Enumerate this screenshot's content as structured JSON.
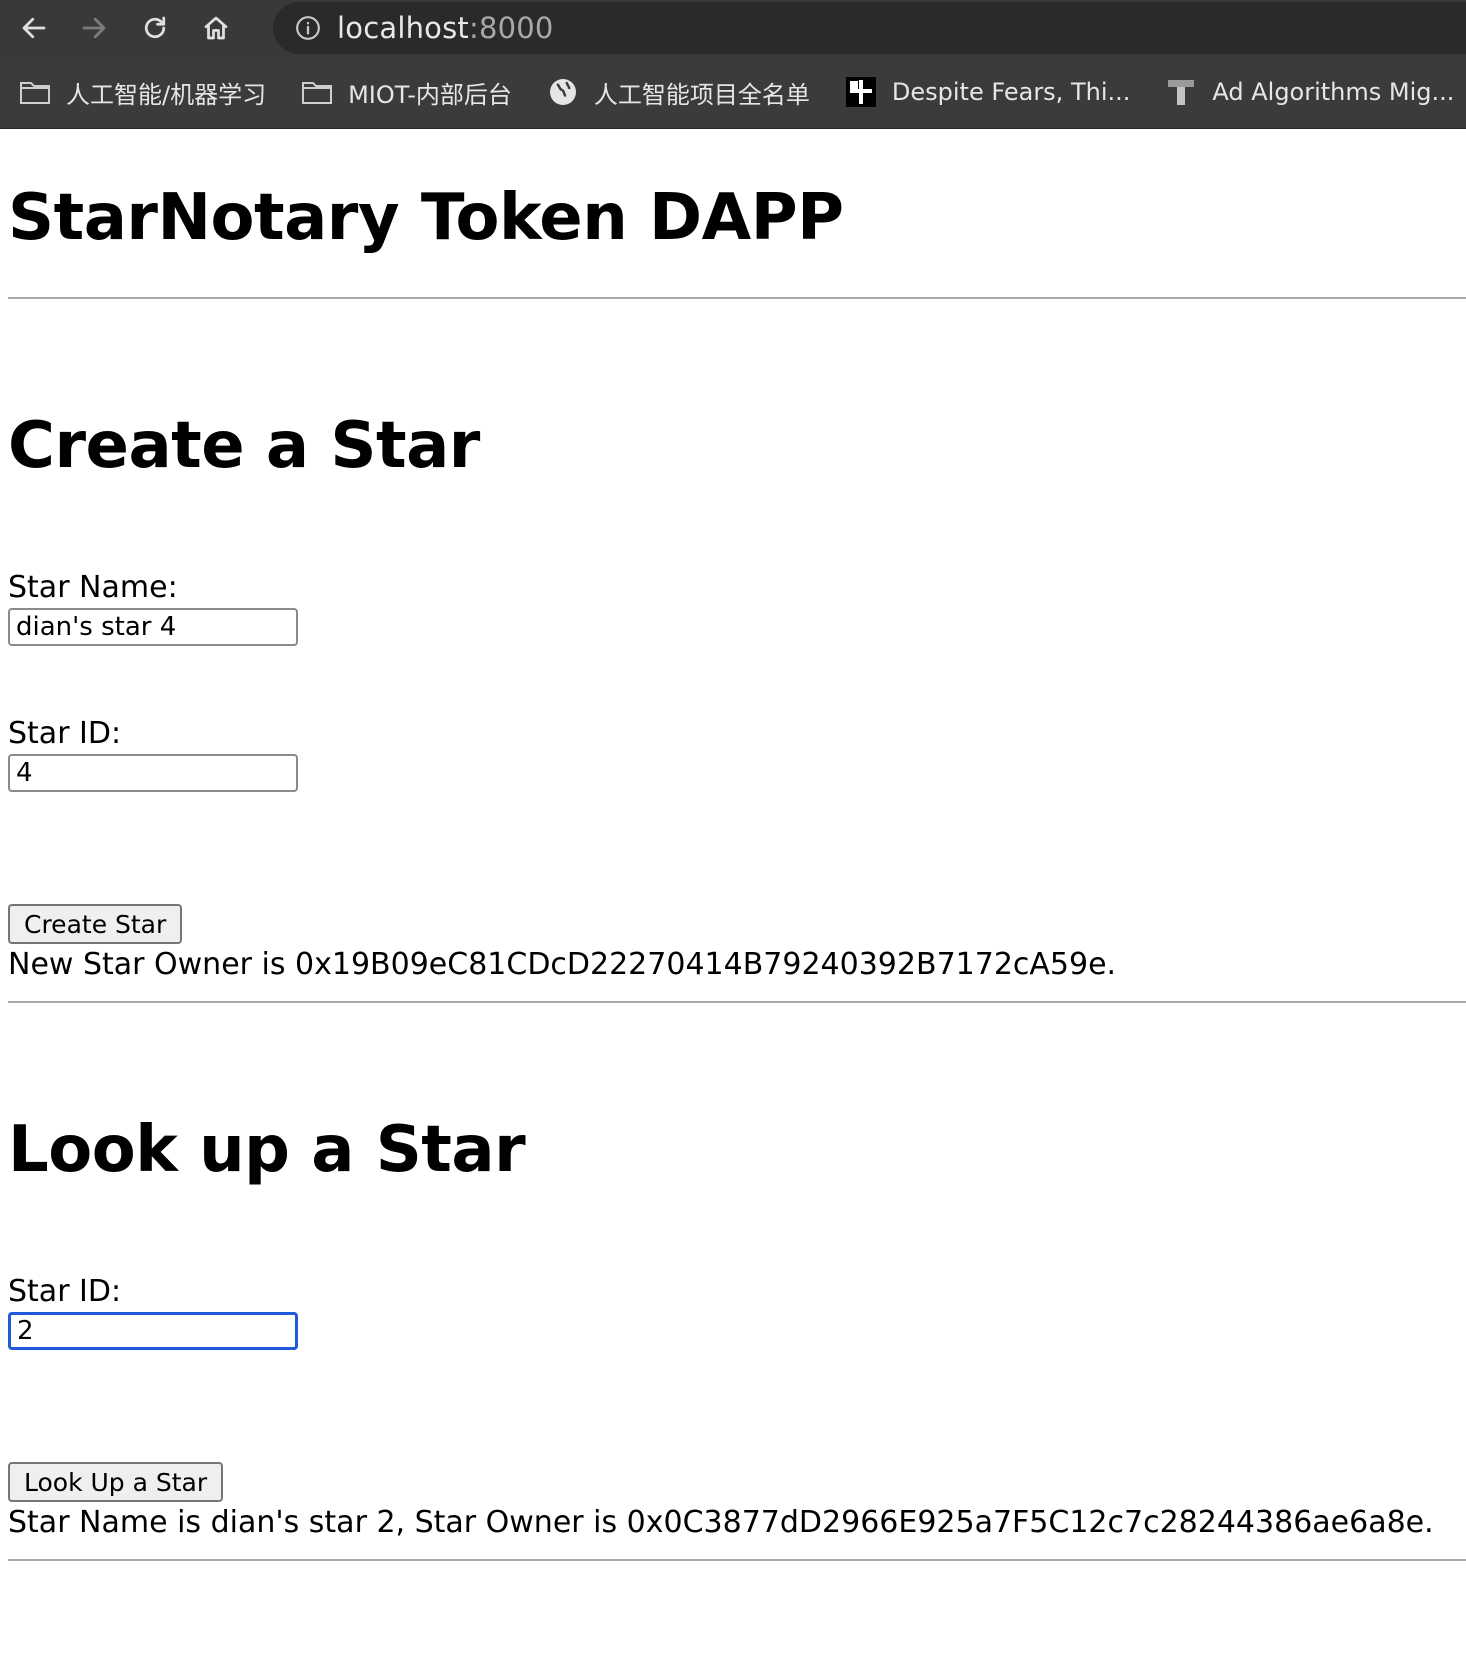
{
  "browser": {
    "url_host": "localhost",
    "url_port": ":8000",
    "bookmarks": [
      {
        "icon": "folder-icon",
        "label": "人工智能/机器学习"
      },
      {
        "icon": "folder-icon",
        "label": "MIOT-内部后台"
      },
      {
        "icon": "globe-icon",
        "label": "人工智能项目全名单"
      },
      {
        "icon": "site-favicon-icon",
        "label": "Despite Fears, Thi..."
      },
      {
        "icon": "site-favicon-icon",
        "label": "Ad Algorithms Mig..."
      }
    ]
  },
  "page": {
    "title": "StarNotary Token DAPP",
    "create": {
      "heading": "Create a Star",
      "name_label": "Star Name:",
      "name_value": "dian's star 4",
      "id_label": "Star ID:",
      "id_value": "4",
      "button": "Create Star",
      "status": "New Star Owner is 0x19B09eC81CDcD22270414B79240392B7172cA59e."
    },
    "lookup": {
      "heading": "Look up a Star",
      "id_label": "Star ID:",
      "id_value": "2",
      "button": "Look Up a Star",
      "status": "Star Name is dian's star 2, Star Owner is 0x0C3877dD2966E925a7F5C12c7c28244386ae6a8e."
    }
  }
}
